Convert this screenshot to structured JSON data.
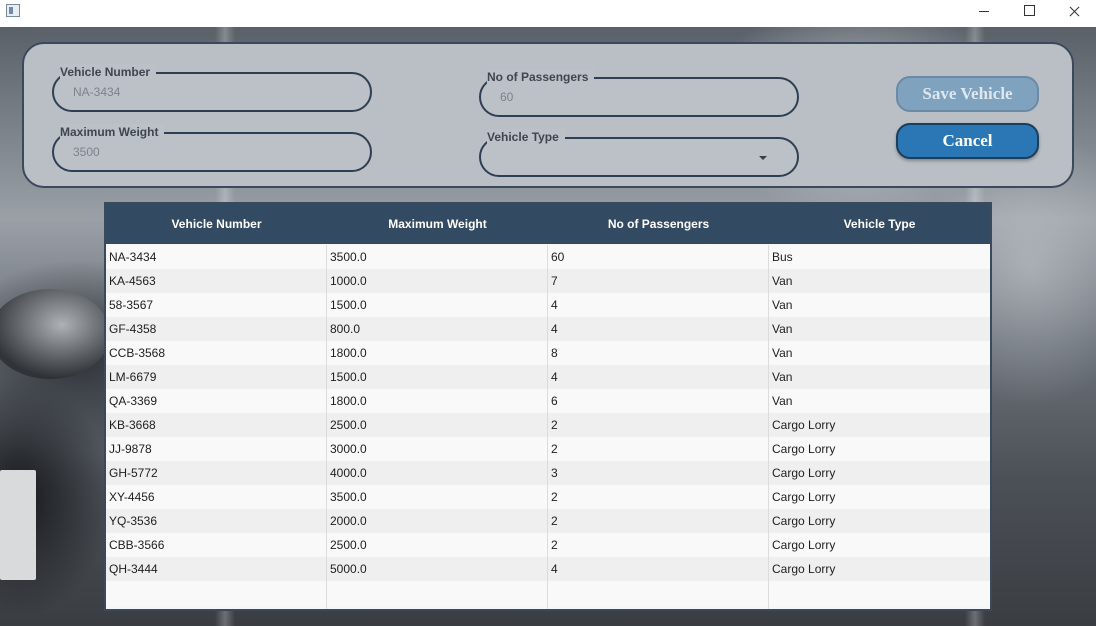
{
  "form": {
    "vehicle_number": {
      "label": "Vehicle Number",
      "value": "NA-3434"
    },
    "passengers": {
      "label": "No of Passengers",
      "value": "60"
    },
    "max_weight": {
      "label": "Maximum Weight",
      "value": "3500"
    },
    "vehicle_type": {
      "label": "Vehicle Type",
      "value": ""
    },
    "save_label": "Save Vehicle",
    "cancel_label": "Cancel"
  },
  "table": {
    "columns": [
      "Vehicle Number",
      "Maximum Weight",
      "No of Passengers",
      "Vehicle Type"
    ],
    "rows": [
      [
        "NA-3434",
        "3500.0",
        "60",
        "Bus"
      ],
      [
        "KA-4563",
        "1000.0",
        "7",
        "Van"
      ],
      [
        "58-3567",
        "1500.0",
        "4",
        "Van"
      ],
      [
        "GF-4358",
        "800.0",
        "4",
        "Van"
      ],
      [
        "CCB-3568",
        "1800.0",
        "8",
        "Van"
      ],
      [
        "LM-6679",
        "1500.0",
        "4",
        "Van"
      ],
      [
        "QA-3369",
        "1800.0",
        "6",
        "Van"
      ],
      [
        "KB-3668",
        "2500.0",
        "2",
        "Cargo Lorry"
      ],
      [
        "JJ-9878",
        "3000.0",
        "2",
        "Cargo Lorry"
      ],
      [
        "GH-5772",
        "4000.0",
        "3",
        "Cargo Lorry"
      ],
      [
        "XY-4456",
        "3500.0",
        "2",
        "Cargo Lorry"
      ],
      [
        "YQ-3536",
        "2000.0",
        "2",
        "Cargo Lorry"
      ],
      [
        "CBB-3566",
        "2500.0",
        "2",
        "Cargo Lorry"
      ],
      [
        "QH-3444",
        "5000.0",
        "4",
        "Cargo Lorry"
      ]
    ]
  },
  "colors": {
    "header_bg": "#334a63",
    "panel_bg": "#b9bfc5",
    "cancel_bg": "#2b77b5",
    "save_bg_disabled": "#7fa3be"
  }
}
